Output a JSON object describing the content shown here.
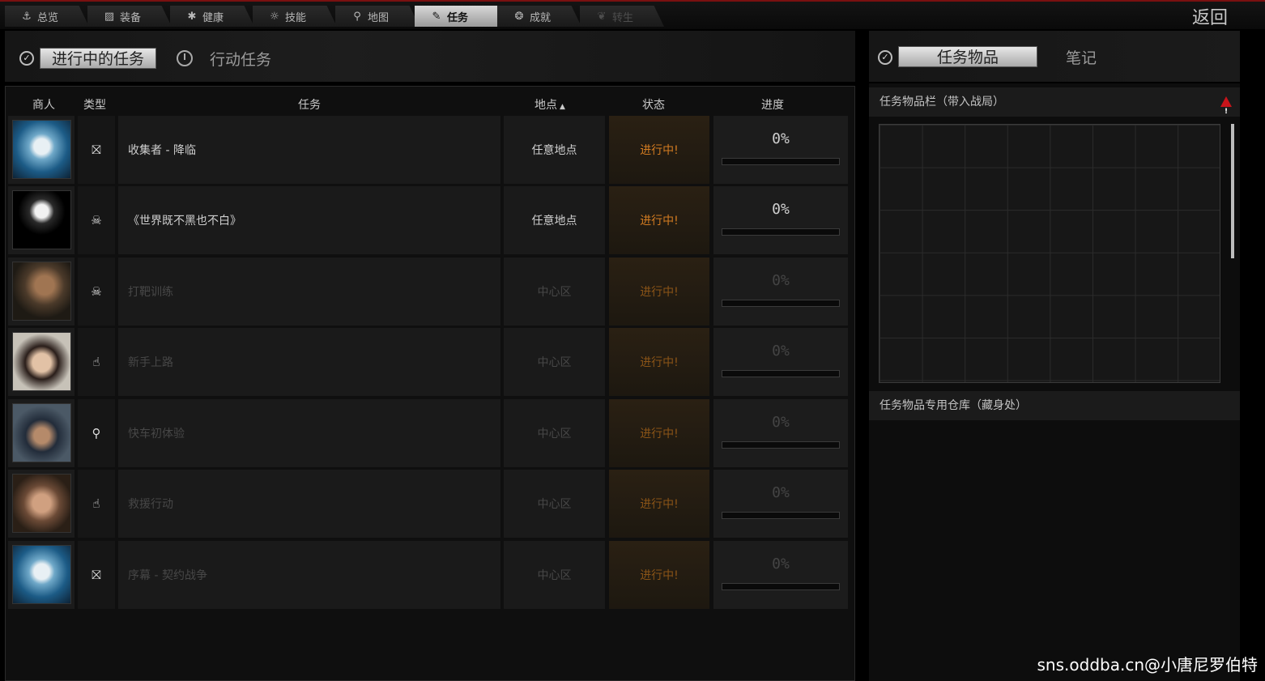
{
  "nav": {
    "tabs": [
      {
        "label": "总览",
        "icon": "anchor-icon",
        "glyph": "⚓"
      },
      {
        "label": "装备",
        "icon": "armor-icon",
        "glyph": "▨"
      },
      {
        "label": "健康",
        "icon": "health-icon",
        "glyph": "✱"
      },
      {
        "label": "技能",
        "icon": "skills-icon",
        "glyph": "☼"
      },
      {
        "label": "地图",
        "icon": "map-pin-icon",
        "glyph": "⚲"
      },
      {
        "label": "任务",
        "icon": "task-icon",
        "glyph": "✎"
      },
      {
        "label": "成就",
        "icon": "achievement-icon",
        "glyph": "❂"
      },
      {
        "label": "转生",
        "icon": "prestige-icon",
        "glyph": "❦"
      }
    ],
    "active_tab": "任务",
    "disabled_tab": "转生",
    "back_label": "返回"
  },
  "left": {
    "subtabs": {
      "active": "进行中的任务",
      "other": "行动任务"
    },
    "columns": {
      "trader": "商人",
      "type": "类型",
      "task": "任务",
      "location": "地点",
      "status": "状态",
      "progress": "进度"
    },
    "rows": [
      {
        "type_icon": "exit-icon",
        "glyph": "⛝",
        "name": "收集者 - 降临",
        "location": "任意地点",
        "status": "进行中!",
        "progress": "0%",
        "progress_value": 0,
        "dim": false,
        "avatar": "avatar-ice"
      },
      {
        "type_icon": "skull-icon",
        "glyph": "☠",
        "name": "《世界既不黑也不白》",
        "location": "任意地点",
        "status": "进行中!",
        "progress": "0%",
        "progress_value": 0,
        "dim": false,
        "avatar": "avatar-joker"
      },
      {
        "type_icon": "skull-icon",
        "glyph": "☠",
        "name": "打靶训练",
        "location": "中心区",
        "status": "进行中!",
        "progress": "0%",
        "progress_value": 0,
        "dim": true,
        "avatar": "avatar-man"
      },
      {
        "type_icon": "hand-icon",
        "glyph": "☝",
        "name": "新手上路",
        "location": "中心区",
        "status": "进行中!",
        "progress": "0%",
        "progress_value": 0,
        "dim": true,
        "avatar": "avatar-woman"
      },
      {
        "type_icon": "search-icon",
        "glyph": "⚲",
        "name": "快车初体验",
        "location": "中心区",
        "status": "进行中!",
        "progress": "0%",
        "progress_value": 0,
        "dim": true,
        "avatar": "avatar-beanie"
      },
      {
        "type_icon": "hand-icon",
        "glyph": "☝",
        "name": "救援行动",
        "location": "中心区",
        "status": "进行中!",
        "progress": "0%",
        "progress_value": 0,
        "dim": true,
        "avatar": "avatar-glasses"
      },
      {
        "type_icon": "exit-icon",
        "glyph": "⛝",
        "name": "序幕 - 契约战争",
        "location": "中心区",
        "status": "进行中!",
        "progress": "0%",
        "progress_value": 0,
        "dim": true,
        "avatar": "avatar-ice"
      }
    ]
  },
  "right": {
    "tabs": {
      "active": "任务物品",
      "other": "笔记"
    },
    "sections": {
      "inventory": "任务物品栏（带入战局）",
      "stash": "任务物品专用仓库（藏身处）"
    }
  },
  "watermark": "sns.oddba.cn@小唐尼罗伯特",
  "colors": {
    "accent_red": "#c8141a",
    "status_orange": "#d27b21"
  }
}
